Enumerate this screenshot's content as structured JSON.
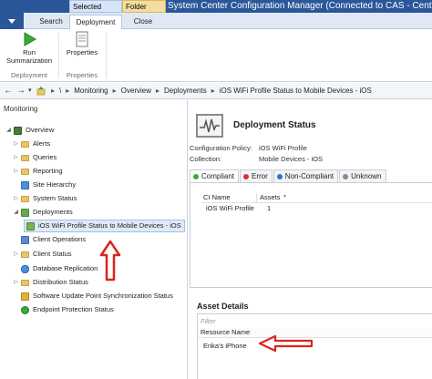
{
  "window": {
    "context_tab_selected": "Selected Object",
    "context_tab_folder": "Folder Tools",
    "title": "System Center Configuration Manager (Connected to CAS - Central A"
  },
  "ribbon_tabs": [
    "Search",
    "Deployment",
    "Close"
  ],
  "ribbon": {
    "run_label_1": "Run",
    "run_label_2": "Summarization",
    "props_label": "Properties",
    "group_deployment": "Deployment",
    "group_properties": "Properties"
  },
  "breadcrumb": {
    "root": "\\",
    "items": [
      "Monitoring",
      "Overview",
      "Deployments",
      "iOS WiFi Profile Status to Mobile Devices - iOS"
    ]
  },
  "left_panel": {
    "header": "Monitoring",
    "items": [
      {
        "label": "Overview",
        "icon": "overview-icon"
      },
      {
        "label": "Alerts",
        "icon": "folder-icon"
      },
      {
        "label": "Queries",
        "icon": "folder-icon"
      },
      {
        "label": "Reporting",
        "icon": "folder-icon"
      },
      {
        "label": "Site Hierarchy",
        "icon": "site-hierarchy-icon"
      },
      {
        "label": "System Status",
        "icon": "folder-icon"
      },
      {
        "label": "Deployments",
        "icon": "deployments-icon"
      },
      {
        "label": "iOS WiFi Profile Status to Mobile Devices - iOS",
        "icon": "deployment-item-icon"
      },
      {
        "label": "Client Operations",
        "icon": "client-operations-icon"
      },
      {
        "label": "Client Status",
        "icon": "folder-icon"
      },
      {
        "label": "Database Replication",
        "icon": "database-replication-icon"
      },
      {
        "label": "Distribution Status",
        "icon": "folder-icon"
      },
      {
        "label": "Software Update Point Synchronization Status",
        "icon": "sync-status-icon"
      },
      {
        "label": "Endpoint Protection Status",
        "icon": "endpoint-protection-icon"
      }
    ]
  },
  "deployment_status": {
    "title": "Deployment Status",
    "config_policy_label": "Configuration Policy:",
    "config_policy_value": "iOS WiFi Profile",
    "collection_label": "Collection:",
    "collection_value": "Mobile Devices - iOS"
  },
  "status_tabs": [
    {
      "label": "Compliant",
      "color": "#3aa935"
    },
    {
      "label": "Error",
      "color": "#d9342b"
    },
    {
      "label": "Non-Compliant",
      "color": "#2f72c4"
    },
    {
      "label": "Unknown",
      "color": "#8a8a8a"
    }
  ],
  "ci_grid": {
    "headers": [
      "CI Name",
      "Assets"
    ],
    "rows": [
      [
        "iOS WiFi Profile",
        "1"
      ]
    ]
  },
  "asset_details": {
    "title": "Asset Details",
    "filter_placeholder": "Filter",
    "column": "Resource Name",
    "rows": [
      "Erika's iPhone"
    ]
  },
  "colors": {
    "accent": "#2b579a",
    "annotation_arrow": "#d9241f"
  }
}
